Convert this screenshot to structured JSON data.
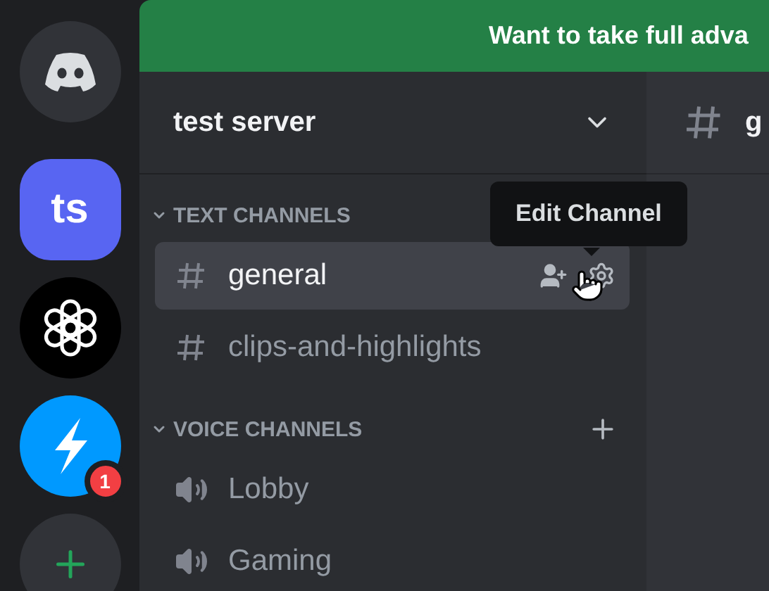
{
  "servers": [
    {
      "kind": "home"
    },
    {
      "kind": "initials",
      "label": "ts"
    },
    {
      "kind": "knot"
    },
    {
      "kind": "bolt",
      "badge": "1"
    },
    {
      "kind": "add"
    }
  ],
  "banner": {
    "text": "Want to take full adva"
  },
  "server_header": {
    "title": "test server"
  },
  "channel_header": {
    "name": "g"
  },
  "categories": [
    {
      "name": "TEXT CHANNELS",
      "expanded": true,
      "can_add": false,
      "channels": [
        {
          "kind": "text",
          "name": "general",
          "selected": true
        },
        {
          "kind": "text",
          "name": "clips-and-highlights",
          "selected": false
        }
      ]
    },
    {
      "name": "VOICE CHANNELS",
      "expanded": true,
      "can_add": true,
      "channels": [
        {
          "kind": "voice",
          "name": "Lobby",
          "selected": false
        },
        {
          "kind": "voice",
          "name": "Gaming",
          "selected": false
        }
      ]
    }
  ],
  "tooltip": {
    "text": "Edit Channel"
  }
}
